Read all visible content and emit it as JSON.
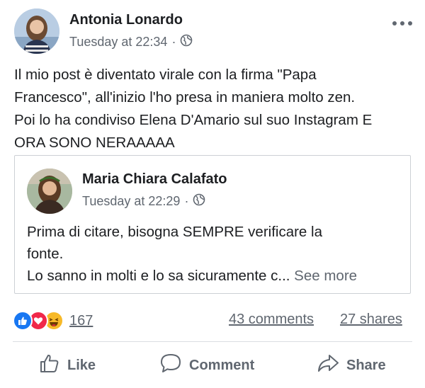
{
  "post": {
    "author": "Antonia Lonardo",
    "timestamp": "Tuesday at 22:34",
    "separator": "·",
    "text": "Il mio post è diventato virale con la firma \"Papa\nFrancesco\", all'inizio l'ho presa in maniera molto zen.\nPoi lo ha condiviso Elena D'Amario sul suo Instagram E\nORA SONO NERAAAAA"
  },
  "shared": {
    "author": "Maria Chiara Calafato",
    "timestamp": "Tuesday at 22:29",
    "separator": "·",
    "line1": "Prima di citare, bisogna SEMPRE verificare la",
    "line2": "fonte.",
    "line3": "Lo sanno in molti e lo sa sicuramente c...",
    "see_more": "See more"
  },
  "stats": {
    "reaction_count": "167",
    "comments": "43 comments",
    "shares": "27 shares"
  },
  "actions": {
    "like": "Like",
    "comment": "Comment",
    "share": "Share"
  },
  "colors": {
    "like_blue": "#1877f2",
    "love_red": "#f0284a",
    "haha_yellow": "#f7b928",
    "meta_gray": "#606770"
  },
  "icons": [
    "more-options-icon",
    "globe-icon",
    "like-reaction-icon",
    "love-reaction-icon",
    "haha-reaction-icon",
    "thumbs-up-icon",
    "comment-icon",
    "share-arrow-icon"
  ]
}
